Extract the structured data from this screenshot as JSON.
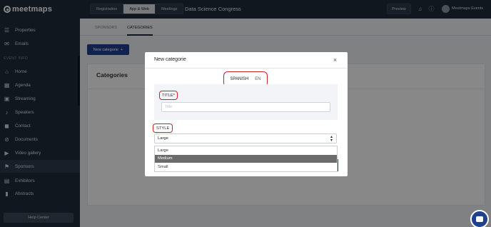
{
  "brand": {
    "name": "meetmaps"
  },
  "sidebar": {
    "top_items": [
      {
        "label": "Properties",
        "icon": "list-icon"
      },
      {
        "label": "Emails",
        "icon": "envelope-icon"
      }
    ],
    "section_label": "EVENT INFO",
    "items": [
      {
        "label": "Home",
        "icon": "home-icon"
      },
      {
        "label": "Agenda",
        "icon": "calendar-icon"
      },
      {
        "label": "Streaming",
        "icon": "video-icon"
      },
      {
        "label": "Speakers",
        "icon": "microphone-icon"
      },
      {
        "label": "Contact",
        "icon": "chat-icon"
      },
      {
        "label": "Documents",
        "icon": "paperclip-icon"
      },
      {
        "label": "Video gallery",
        "icon": "camera-icon"
      },
      {
        "label": "Sponsors",
        "icon": "flag-icon",
        "active": true
      },
      {
        "label": "Exhibitors",
        "icon": "store-icon"
      },
      {
        "label": "Abstracts",
        "icon": "bookmark-icon"
      }
    ],
    "help_label": "Help Center"
  },
  "topbar": {
    "tabs": [
      "Registration",
      "App & Web",
      "Meetings"
    ],
    "active_tab": "App & Web",
    "event_title": "Data Science Congress",
    "preview_label": "Preview",
    "user_name": "Meetmaps Events"
  },
  "subnav": {
    "tabs": [
      "SPONSORS",
      "CATEGORIES"
    ],
    "active_tab": "CATEGORIES"
  },
  "content": {
    "new_button_label": "New categorie",
    "new_button_icon": "+",
    "card_title": "Categories"
  },
  "modal": {
    "title": "New categorie",
    "close_icon": "×",
    "languages": [
      "SPANISH",
      "EN"
    ],
    "title_label": "TITLE*",
    "title_placeholder": "Title",
    "style_label": "STYLE",
    "style_selected": "Large",
    "style_options": [
      "Large",
      "Medium",
      "Small"
    ],
    "highlighted_option": "Medium"
  },
  "colors": {
    "sidebar_bg": "#1f2a3a",
    "primary": "#1f3f8f",
    "highlight": "#d41f26"
  }
}
